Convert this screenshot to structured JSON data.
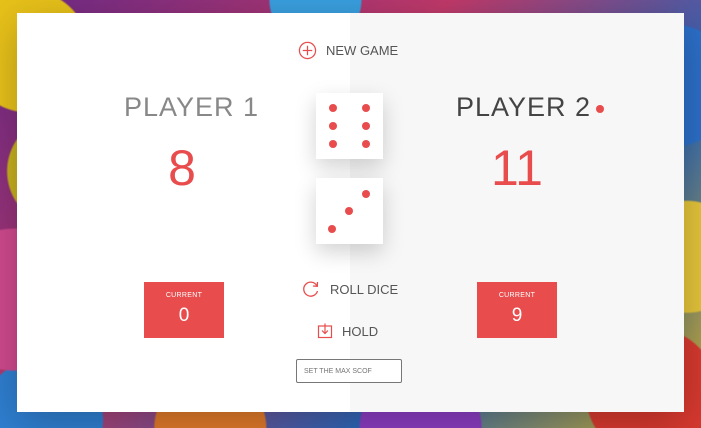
{
  "buttons": {
    "new_game": "New game",
    "roll_dice": "Roll dice",
    "hold": "Hold"
  },
  "players": [
    {
      "name": "Player 1",
      "score": "8",
      "current_label": "Current",
      "current_value": "0",
      "active": false
    },
    {
      "name": "Player 2",
      "score": "11",
      "current_label": "Current",
      "current_value": "9",
      "active": true
    }
  ],
  "dice": [
    6,
    3
  ],
  "max_score_input": {
    "placeholder": "Set the max scof",
    "value": ""
  },
  "colors": {
    "accent": "#e84c4c"
  },
  "icons": {
    "new_game": "plus-circle-icon",
    "roll_dice": "refresh-icon",
    "hold": "download-icon"
  }
}
